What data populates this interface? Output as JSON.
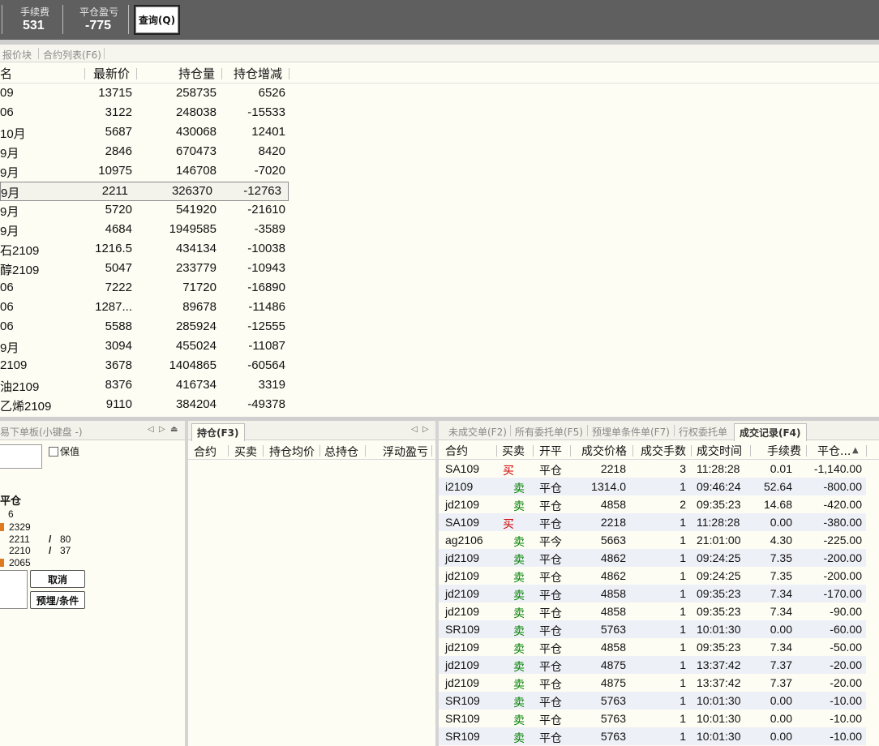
{
  "topbar": {
    "fee_label": "手续费",
    "fee_value": "531",
    "pnl_label": "平仓盈亏",
    "pnl_value": "-775",
    "query_button": "查询(Q)"
  },
  "quote_tabs": [
    "报价块",
    "合约列表(F6)"
  ],
  "quote_table": {
    "headers": [
      "名",
      "最新价",
      "持仓量",
      "持仓增减"
    ],
    "rows": [
      [
        "09",
        "13715",
        "258735",
        "6526"
      ],
      [
        "06",
        "3122",
        "248038",
        "-15533"
      ],
      [
        "10月",
        "5687",
        "430068",
        "12401"
      ],
      [
        "9月",
        "2846",
        "670473",
        "8420"
      ],
      [
        "9月",
        "10975",
        "146708",
        "-7020"
      ],
      [
        "9月",
        "2211",
        "326370",
        "-12763"
      ],
      [
        "9月",
        "5720",
        "541920",
        "-21610"
      ],
      [
        "9月",
        "4684",
        "1949585",
        "-3589"
      ],
      [
        "石2109",
        "1216.5",
        "434134",
        "-10038"
      ],
      [
        "醇2109",
        "5047",
        "233779",
        "-10943"
      ],
      [
        "06",
        "7222",
        "71720",
        "-16890"
      ],
      [
        "06",
        "1287...",
        "89678",
        "-11486"
      ],
      [
        "06",
        "5588",
        "285924",
        "-12555"
      ],
      [
        "9月",
        "3094",
        "455024",
        "-11087"
      ],
      [
        "2109",
        "3678",
        "1404865",
        "-60564"
      ],
      [
        "油2109",
        "8376",
        "416734",
        "3319"
      ],
      [
        "乙烯2109",
        "9110",
        "384204",
        "-49378"
      ]
    ],
    "selected_row": 5
  },
  "order_panel": {
    "tab": "易下单板(小键盘 -)",
    "keep_label": "保值",
    "mode": "平仓",
    "qty": "6",
    "lines": [
      {
        "label": "",
        "value": "2329",
        "extra": ""
      },
      {
        "label": "",
        "value": "2211",
        "extra": "80"
      },
      {
        "label": "",
        "value": "2210",
        "extra": "37"
      },
      {
        "label": "",
        "value": "2065",
        "extra": ""
      }
    ],
    "cancel_button": "取消",
    "condition_button": "预埋/条件"
  },
  "position_panel": {
    "tab": "持仓(F3)",
    "headers": [
      "合约",
      "买卖",
      "持仓均价",
      "总持仓",
      "浮动盈亏"
    ]
  },
  "trade_panel": {
    "tabs": [
      "未成交单(F2)",
      "所有委托单(F5)",
      "预埋单条件单(F7)",
      "行权委托单",
      "成交记录(F4)"
    ],
    "headers": [
      "合约",
      "买卖",
      "开平",
      "成交价格",
      "成交手数",
      "成交时间",
      "手续费",
      "平仓..."
    ],
    "rows": [
      [
        "SA109",
        "买",
        "平仓",
        "2218",
        "3",
        "11:28:28",
        "0.01",
        "-1,140.00"
      ],
      [
        "i2109",
        "卖",
        "平仓",
        "1314.0",
        "1",
        "09:46:24",
        "52.64",
        "-800.00"
      ],
      [
        "jd2109",
        "卖",
        "平仓",
        "4858",
        "2",
        "09:35:23",
        "14.68",
        "-420.00"
      ],
      [
        "SA109",
        "买",
        "平仓",
        "2218",
        "1",
        "11:28:28",
        "0.00",
        "-380.00"
      ],
      [
        "ag2106",
        "卖",
        "平今",
        "5663",
        "1",
        "21:01:00",
        "4.30",
        "-225.00"
      ],
      [
        "jd2109",
        "卖",
        "平仓",
        "4862",
        "1",
        "09:24:25",
        "7.35",
        "-200.00"
      ],
      [
        "jd2109",
        "卖",
        "平仓",
        "4862",
        "1",
        "09:24:25",
        "7.35",
        "-200.00"
      ],
      [
        "jd2109",
        "卖",
        "平仓",
        "4858",
        "1",
        "09:35:23",
        "7.34",
        "-170.00"
      ],
      [
        "jd2109",
        "卖",
        "平仓",
        "4858",
        "1",
        "09:35:23",
        "7.34",
        "-90.00"
      ],
      [
        "SR109",
        "卖",
        "平仓",
        "5763",
        "1",
        "10:01:30",
        "0.00",
        "-60.00"
      ],
      [
        "jd2109",
        "卖",
        "平仓",
        "4858",
        "1",
        "09:35:23",
        "7.34",
        "-50.00"
      ],
      [
        "jd2109",
        "卖",
        "平仓",
        "4875",
        "1",
        "13:37:42",
        "7.37",
        "-20.00"
      ],
      [
        "jd2109",
        "卖",
        "平仓",
        "4875",
        "1",
        "13:37:42",
        "7.37",
        "-20.00"
      ],
      [
        "SR109",
        "卖",
        "平仓",
        "5763",
        "1",
        "10:01:30",
        "0.00",
        "-10.00"
      ],
      [
        "SR109",
        "卖",
        "平仓",
        "5763",
        "1",
        "10:01:30",
        "0.00",
        "-10.00"
      ],
      [
        "SR109",
        "卖",
        "平仓",
        "5763",
        "1",
        "10:01:30",
        "0.00",
        "-10.00"
      ]
    ]
  },
  "colors": {
    "topbar_bg": "#5f5f5f",
    "panel_bg": "#fdfdf3",
    "buy": "#d00000",
    "sell": "#008000",
    "alt_row": "#eef0f7"
  }
}
